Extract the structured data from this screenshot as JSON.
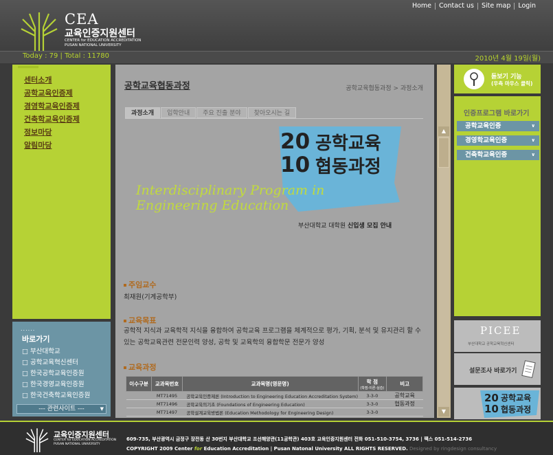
{
  "header": {
    "logo_cea": "CEA",
    "logo_kor": "교육인증지원센터",
    "logo_en1": "CENTER for EDUCATION ACCREDITATION",
    "logo_en2": "PUSAN NATIONAL UNIVERSITY",
    "topnav": [
      "Home",
      "Contact us",
      "Site map",
      "Login"
    ],
    "counter": "Today : 79   |   Total : 11780",
    "date": "2010년 4월 19일(월)"
  },
  "left_menu": {
    "items": [
      "센터소개",
      "공학교육인증제",
      "경영학교육인증제",
      "건축학교육인증제",
      "정보마당",
      "알림마당"
    ]
  },
  "shortcuts": {
    "dots": "......",
    "title": "바로가기",
    "items": [
      "부산대학교",
      "공학교육혁신센터",
      "한국공학교육인증원",
      "한국경영교육인증원",
      "한국건축학교육인증원"
    ],
    "related": "---   관련사이트   ---"
  },
  "content": {
    "page_title": "공학교육협동과정",
    "breadcrumb": "공학교육협동과정  >  과정소개",
    "tabs": [
      "과정소개",
      "입학안내",
      "주요 진출 분야",
      "찾아오시는 길"
    ],
    "banner": {
      "num1": "20",
      "num2": "10",
      "kor1": "공학교육",
      "kor2": "협동과정",
      "en1": "Interdisciplinary Program in",
      "en2": "Engineering Education",
      "sub_prefix": "부산대학교 대학원 ",
      "sub_bold": "신입생 모집 안내"
    },
    "sections": [
      {
        "title": "주임교수",
        "text": "최재원(기계공학부)"
      },
      {
        "title": "교육목표",
        "text": "공학적 지식과 교육학적 지식을 융합하여 공학교육 프로그램을 체계적으로 평가, 기획, 분석 및 유지관리 할 수 있는 공학교육관련 전문인력 양성, 공학 및 교육학의 융합학문 전문가 양성"
      },
      {
        "title": "교육과정",
        "text": ""
      }
    ],
    "table": {
      "headers": [
        "이수구분",
        "교과목번호",
        "교과목명(영문명)",
        "학 점",
        "비고"
      ],
      "credit_sub": "(학점-이론-실습)",
      "rows": [
        {
          "code": "MT71495",
          "name": "공학교육인증제론 (Introduction to Engineering Education Accreditation System)",
          "credit": "3-3-0",
          "note": "공학교육"
        },
        {
          "code": "MT71496",
          "name": "공학교육의기초 (Foundations of Engineering Education)",
          "credit": "3-3-0",
          "note": "협동과정"
        },
        {
          "code": "MT71497",
          "name": "공학설계교육방법론 (Education Methodology for Engineering Design)",
          "credit": "3-3-0",
          "note": ""
        }
      ]
    }
  },
  "right": {
    "zoom_line1": "돋보기 기능",
    "zoom_line2": "(우측 마우스 클릭)",
    "cert_title": "인증프로그램 바로가기",
    "cert_items": [
      "공학교육인증",
      "경영학교육인증",
      "건축학교육인증"
    ],
    "picee_title": "PICEE",
    "picee_sub": "부산대학교 공학교육혁신센터",
    "survey": "설문조사 바로가기",
    "promo_num1": "20",
    "promo_num2": "10",
    "promo_kor1": "공학교육",
    "promo_kor2": "협동과정"
  },
  "footer": {
    "kor": "교육인증지원센터",
    "en1": "CENTER for EDUCATION ACCREDITATION",
    "en2": "PUSAN NATIONAL UNIVERSITY",
    "address": "609-735, 부산광역시 금정구 장전동 산 30번지 부산대학교 조선해양관(11공학관) 403호 교육인증지원센터   전화 051-510-3754, 3736  |  팩스 051-514-2736",
    "copy_a": "COPYRIGHT 2009 Center ",
    "copy_for": "for",
    "copy_b": " Education Accreditation  |  Pusan Natonal University  ALL RIGHTS RESERVED.",
    "copy_design": "  Designed by ringdesign consultancy"
  },
  "colors": {
    "lime": "#b6d235",
    "blue": "#6c95a5",
    "content_bg": "#a4a4a4",
    "header_bg": "#444444"
  }
}
